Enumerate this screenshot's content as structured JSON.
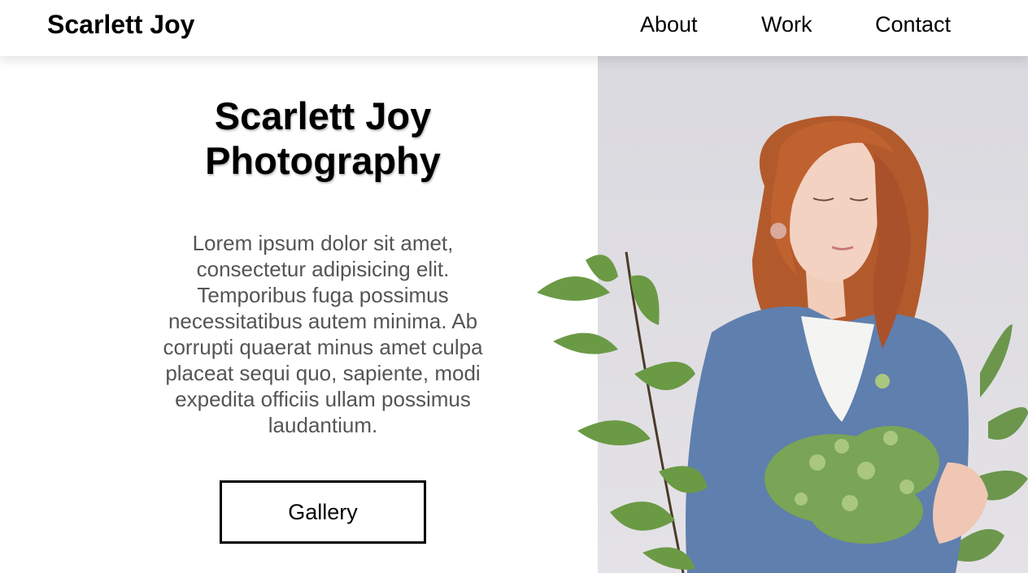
{
  "header": {
    "brand": "Scarlett Joy",
    "nav": [
      {
        "label": "About"
      },
      {
        "label": "Work"
      },
      {
        "label": "Contact"
      }
    ]
  },
  "hero": {
    "title_line1": "Scarlett Joy",
    "title_line2": "Photography",
    "body": "Lorem ipsum dolor sit amet, consectetur adipisicing elit. Temporibus fuga possimus necessitatibus autem minima. Ab corrupti quaerat minus amet culpa placeat sequi quo, sapiente, modi expedita officiis ullam possimus laudantium.",
    "button_label": "Gallery"
  },
  "colors": {
    "photo_background": "#dad9df",
    "body_text": "#555555",
    "hair": "#b8592e",
    "sweater": "#5c7ba8",
    "leaves": "#6b9a45"
  },
  "icons": [
    "woman-portrait-image",
    "plant-image"
  ]
}
